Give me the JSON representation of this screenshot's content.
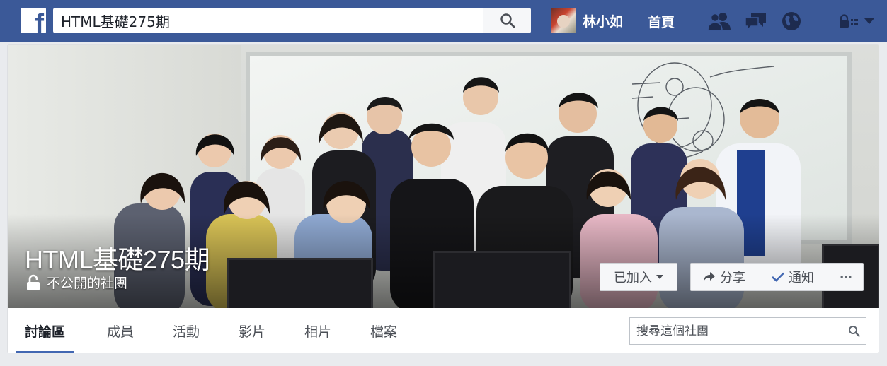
{
  "topbar": {
    "logo_letter": "f",
    "search_value": "HTML基礎275期",
    "profile_name": "林小如",
    "home_label": "首頁",
    "icons": [
      "friend-requests-icon",
      "messages-icon",
      "notifications-globe-icon",
      "privacy-shortcuts-icon",
      "account-menu-chevron-icon"
    ]
  },
  "group": {
    "name": "HTML基礎275期",
    "privacy": "不公開的社團"
  },
  "cover_buttons": {
    "joined": "已加入",
    "share": "分享",
    "notify": "通知",
    "more": "···"
  },
  "tabs": [
    {
      "label": "討論區",
      "active": true
    },
    {
      "label": "成員"
    },
    {
      "label": "活動"
    },
    {
      "label": "影片"
    },
    {
      "label": "相片"
    },
    {
      "label": "檔案"
    }
  ],
  "group_search": {
    "placeholder": "搜尋這個社團"
  },
  "colors": {
    "brand_blue": "#3b5998",
    "tab_underline": "#4267b2",
    "page_bg": "#e9ebee"
  }
}
